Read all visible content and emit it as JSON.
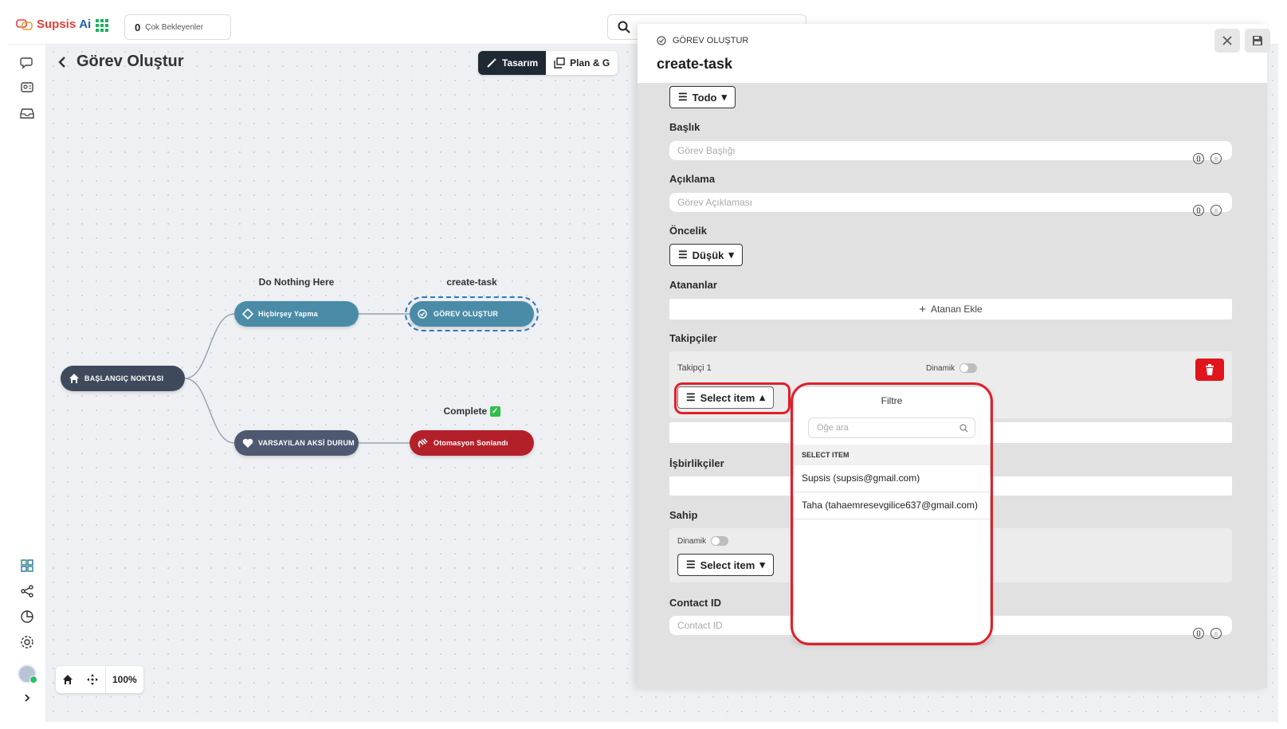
{
  "app": {
    "logo_name": "Supsis",
    "logo_ai": "Ai",
    "pending_count": "0",
    "pending_label": "Çok Bekleyenler"
  },
  "canvas": {
    "title": "Görev Oluştur",
    "mode_design": "Tasarım",
    "mode_plan": "Plan & G",
    "zoom": "100%",
    "nodes": {
      "start": "BAŞLANGIÇ NOKTASI",
      "none_label": "Do Nothing Here",
      "none": "Hiçbirşey Yapma",
      "task_label": "create-task",
      "task": "GÖREV OLUŞTUR",
      "default": "VARSAYILAN AKSİ DURUM",
      "end_label": "Complete",
      "end": "Otomasyon Sonlandı"
    }
  },
  "panel": {
    "kind": "GÖREV OLUŞTUR",
    "title": "create-task",
    "status": "Todo",
    "title_label": "Başlık",
    "title_placeholder": "Görev Başlığı",
    "desc_label": "Açıklama",
    "desc_placeholder": "Görev Açıklaması",
    "priority_label": "Öncelik",
    "priority": "Düşük",
    "assignees_label": "Atananlar",
    "add_assignee": "Atanan Ekle",
    "followers_label": "Takipçiler",
    "follower_1": "Takipçi 1",
    "dynamic": "Dinamik",
    "select_item": "Select item",
    "collaborators_label": "İşbirlikçiler",
    "owner_label": "Sahip",
    "owner_dynamic": "Dinamik",
    "owner_select": "Select item",
    "contact_label": "Contact ID",
    "contact_placeholder": "Contact ID"
  },
  "dropdown": {
    "header": "Filtre",
    "search_placeholder": "Öğe ara",
    "section": "SELECT ITEM",
    "options": [
      "Supsis (supsis@gmail.com)",
      "Taha (tahaemresevgilice637@gmail.com)"
    ]
  },
  "colors": {
    "brand_red": "#e2423d",
    "brand_blue": "#1f5fae",
    "highlight_red": "#e0202a",
    "node_teal": "#4a8ca8",
    "node_red": "#b4202a"
  }
}
